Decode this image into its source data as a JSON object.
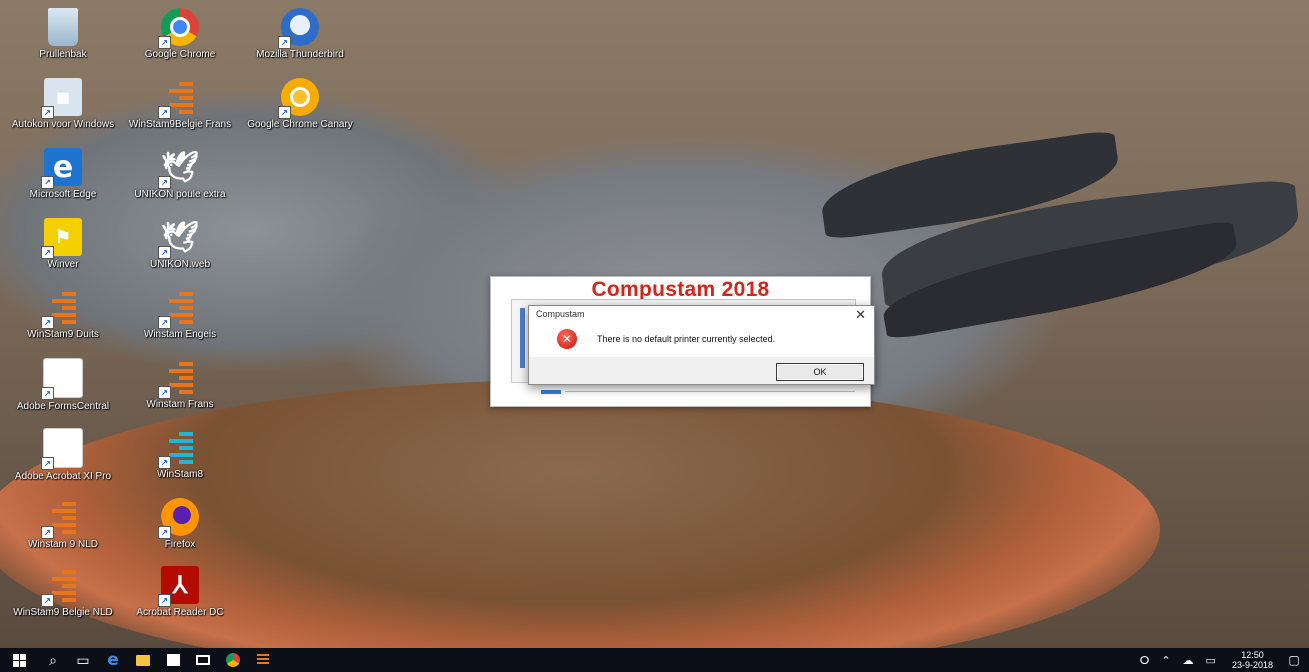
{
  "desktop": {
    "icons": [
      {
        "label": "Prullenbak",
        "icon": "recycle-bin-icon"
      },
      {
        "label": "Google Chrome",
        "icon": "chrome-icon"
      },
      {
        "label": "Mozilla Thunderbird",
        "icon": "thunderbird-icon"
      },
      {
        "label": "Autokon voor Windows",
        "icon": "autokon-icon"
      },
      {
        "label": "WinStam9Belgie Frans",
        "icon": "winstam-icon"
      },
      {
        "label": "Google Chrome Canary",
        "icon": "chrome-canary-icon"
      },
      {
        "label": "Microsoft Edge",
        "icon": "edge-icon"
      },
      {
        "label": "UNIKON poule extra",
        "icon": "unikon-bird-icon"
      },
      {
        "label": "Winver",
        "icon": "winver-icon"
      },
      {
        "label": "UNIKON.web",
        "icon": "unikon-web-icon"
      },
      {
        "label": "WinStam9 Duits",
        "icon": "winstam-icon"
      },
      {
        "label": "Winstam Engels",
        "icon": "winstam-icon"
      },
      {
        "label": "Adobe FormsCentral",
        "icon": "forms-central-icon"
      },
      {
        "label": "Winstam Frans",
        "icon": "winstam-icon"
      },
      {
        "label": "Adobe Acrobat XI Pro",
        "icon": "acrobat-icon"
      },
      {
        "label": "WinStam8",
        "icon": "winstam8-icon"
      },
      {
        "label": "Winstam 9 NLD",
        "icon": "winstam-icon"
      },
      {
        "label": "Firefox",
        "icon": "firefox-icon"
      },
      {
        "label": "WinStam9 Belgie NLD",
        "icon": "winstam-icon"
      },
      {
        "label": "Acrobat Reader DC",
        "icon": "acrobat-reader-icon"
      }
    ]
  },
  "splash": {
    "title": "Compustam 2018"
  },
  "msgbox": {
    "title": "Compustam",
    "close_glyph": "✕",
    "message": "There is no default printer currently selected.",
    "ok_label": "OK"
  },
  "taskbar": {
    "items": [
      "start-button",
      "search-icon",
      "task-view-icon",
      "edge-icon",
      "file-explorer-icon",
      "store-icon",
      "mail-icon",
      "chrome-icon",
      "winstam-icon"
    ],
    "time": "12:50",
    "date": "23-9-2018"
  },
  "colors": {
    "splash_title": "#d62418",
    "taskbar": "#0c0f18",
    "progress": "#3b7dd8"
  }
}
